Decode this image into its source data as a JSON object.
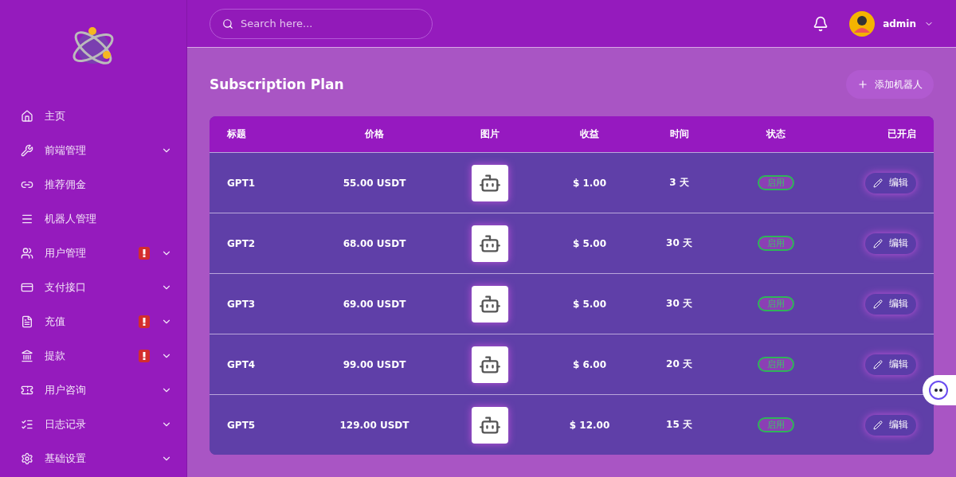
{
  "sidebar": {
    "items": [
      {
        "label": "主页",
        "alert": false,
        "expandable": false
      },
      {
        "label": "前端管理",
        "alert": false,
        "expandable": true
      },
      {
        "label": "推荐佣金",
        "alert": false,
        "expandable": false
      },
      {
        "label": "机器人管理",
        "alert": false,
        "expandable": false
      },
      {
        "label": "用户管理",
        "alert": true,
        "expandable": true
      },
      {
        "label": "支付接口",
        "alert": false,
        "expandable": true
      },
      {
        "label": "充值",
        "alert": true,
        "expandable": true
      },
      {
        "label": "提款",
        "alert": true,
        "expandable": true
      },
      {
        "label": "用户咨询",
        "alert": false,
        "expandable": true
      },
      {
        "label": "日志记录",
        "alert": false,
        "expandable": true
      },
      {
        "label": "基础设置",
        "alert": false,
        "expandable": true
      }
    ]
  },
  "header": {
    "search": {
      "placeholder": "Search here..."
    },
    "user": "admin"
  },
  "page": {
    "title": "Subscription Plan",
    "add_button": "添加机器人"
  },
  "table": {
    "columns": [
      "标题",
      "价格",
      "图片",
      "收益",
      "时间",
      "状态",
      "已开启"
    ],
    "rows": [
      {
        "title": "GPT1",
        "price": "55.00 USDT",
        "profit": "$ 1.00",
        "time": "3 天",
        "status": "启用",
        "action": "编辑"
      },
      {
        "title": "GPT2",
        "price": "68.00 USDT",
        "profit": "$ 5.00",
        "time": "30 天",
        "status": "启用",
        "action": "编辑"
      },
      {
        "title": "GPT3",
        "price": "69.00 USDT",
        "profit": "$ 5.00",
        "time": "30 天",
        "status": "启用",
        "action": "编辑"
      },
      {
        "title": "GPT4",
        "price": "99.00 USDT",
        "profit": "$ 6.00",
        "time": "20 天",
        "status": "启用",
        "action": "编辑"
      },
      {
        "title": "GPT5",
        "price": "129.00 USDT",
        "profit": "$ 12.00",
        "time": "15 天",
        "status": "启用",
        "action": "编辑"
      }
    ]
  }
}
